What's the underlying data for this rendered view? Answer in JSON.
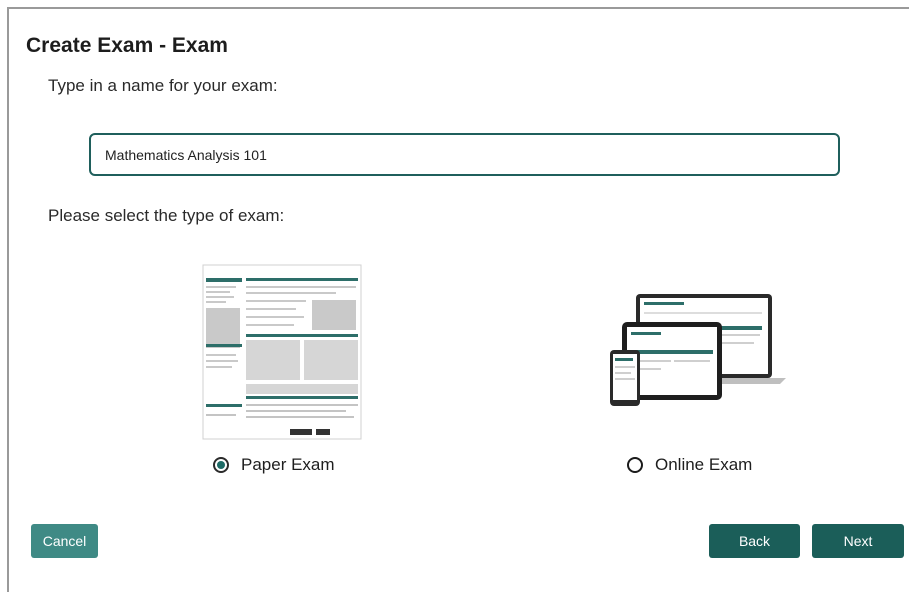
{
  "dialog": {
    "title": "Create Exam - Exam",
    "name_prompt": "Type in a name for your exam:",
    "exam_name_value": "Mathematics Analysis 101",
    "type_prompt": "Please select the type of exam:"
  },
  "exam_types": [
    {
      "label": "Paper Exam",
      "selected": true,
      "illustration": "paper-exam-sheet"
    },
    {
      "label": "Online Exam",
      "selected": false,
      "illustration": "devices-laptop-tablet-phone"
    }
  ],
  "buttons": {
    "cancel": "Cancel",
    "back": "Back",
    "next": "Next"
  },
  "colors": {
    "primary": "#1b5e59",
    "cancel": "#3f8a85",
    "input_border": "#1f5f5c"
  }
}
